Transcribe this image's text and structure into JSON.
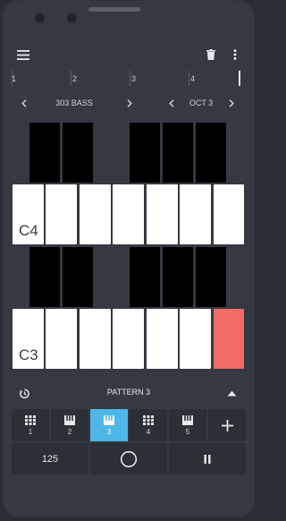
{
  "toolbar": {
    "menu_icon": "hamburger-menu-icon",
    "delete_icon": "trash-icon",
    "more_icon": "more-vert-icon"
  },
  "timeline": {
    "markers": [
      "1",
      "2",
      "3",
      "4"
    ]
  },
  "instrument": {
    "name": "303 BASS",
    "prev_icon": "chevron-left-icon",
    "next_icon": "chevron-right-icon"
  },
  "octave": {
    "label": "OCT 3",
    "prev_icon": "chevron-left-icon",
    "next_icon": "chevron-right-icon"
  },
  "keyboard": {
    "upper_octave_label": "C4",
    "lower_octave_label": "C3",
    "highlighted_key": "B3",
    "highlight_color": "#f36b66"
  },
  "pattern": {
    "name": "PATTERN 3",
    "loop_icon": "timer-reset-icon",
    "collapse_icon": "triangle-up-icon"
  },
  "tracks": [
    {
      "label": "1",
      "icon": "grid-icon",
      "active": false
    },
    {
      "label": "2",
      "icon": "piano-icon",
      "active": false
    },
    {
      "label": "3",
      "icon": "piano-icon",
      "active": true
    },
    {
      "label": "4",
      "icon": "grid-icon",
      "active": false
    },
    {
      "label": "5",
      "icon": "piano-icon",
      "active": false
    }
  ],
  "add_track_icon": "plus-icon",
  "transport": {
    "tempo": "125",
    "record_icon": "circle-record-icon",
    "pause_icon": "pause-icon"
  },
  "colors": {
    "accent": "#4db8e8",
    "background": "#363941",
    "panel": "#2c2f35"
  }
}
